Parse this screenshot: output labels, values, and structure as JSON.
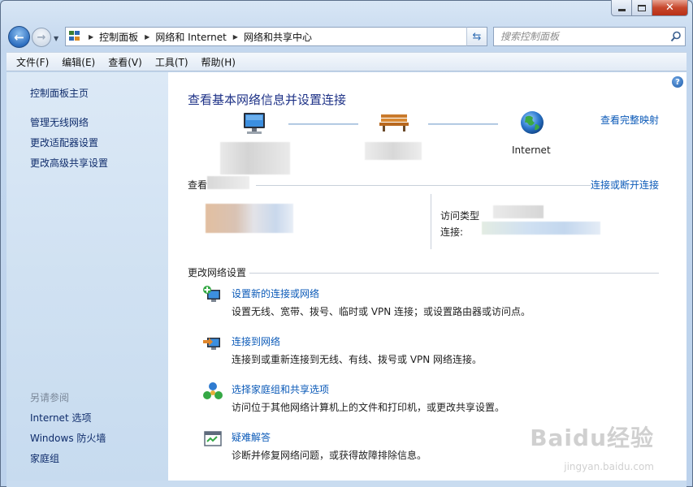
{
  "window": {
    "title": "网络和共享中心"
  },
  "address": {
    "crumbs": [
      "控制面板",
      "网络和 Internet",
      "网络和共享中心"
    ]
  },
  "search": {
    "placeholder": "搜索控制面板"
  },
  "menu": [
    "文件(F)",
    "编辑(E)",
    "查看(V)",
    "工具(T)",
    "帮助(H)"
  ],
  "sidebar": {
    "home": "控制面板主页",
    "items": [
      "管理无线网络",
      "更改适配器设置",
      "更改高级共享设置"
    ],
    "see_also_heading": "另请参阅",
    "see_also": [
      "Internet 选项",
      "Windows 防火墙",
      "家庭组"
    ]
  },
  "main": {
    "title": "查看基本网络信息并设置连接",
    "full_map_link": "查看完整映射",
    "internet_label": "Internet",
    "active_networks_label": "查看",
    "connect_disconnect_link": "连接或断开连接",
    "access_type_label": "访问类型",
    "connections_label": "连接:",
    "change_settings_label": "更改网络设置",
    "tasks": [
      {
        "icon": "setup-connection-icon",
        "link": "设置新的连接或网络",
        "desc": "设置无线、宽带、拨号、临时或 VPN 连接；或设置路由器或访问点。"
      },
      {
        "icon": "connect-network-icon",
        "link": "连接到网络",
        "desc": "连接到或重新连接到无线、有线、拨号或 VPN 网络连接。"
      },
      {
        "icon": "homegroup-icon",
        "link": "选择家庭组和共享选项",
        "desc": "访问位于其他网络计算机上的文件和打印机，或更改共享设置。"
      },
      {
        "icon": "troubleshoot-icon",
        "link": "疑难解答",
        "desc": "诊断并修复网络问题，或获得故障排除信息。"
      }
    ]
  },
  "watermark": {
    "brand": "Baidu经验",
    "url": "jingyan.baidu.com"
  }
}
